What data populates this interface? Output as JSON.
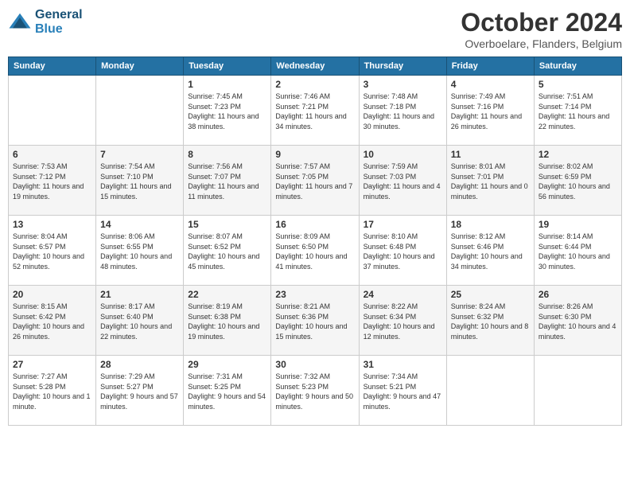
{
  "header": {
    "logo_line1": "General",
    "logo_line2": "Blue",
    "title": "October 2024",
    "subtitle": "Overboelare, Flanders, Belgium"
  },
  "days_of_week": [
    "Sunday",
    "Monday",
    "Tuesday",
    "Wednesday",
    "Thursday",
    "Friday",
    "Saturday"
  ],
  "weeks": [
    [
      {
        "day": "",
        "sunrise": "",
        "sunset": "",
        "daylight": ""
      },
      {
        "day": "",
        "sunrise": "",
        "sunset": "",
        "daylight": ""
      },
      {
        "day": "1",
        "sunrise": "Sunrise: 7:45 AM",
        "sunset": "Sunset: 7:23 PM",
        "daylight": "Daylight: 11 hours and 38 minutes."
      },
      {
        "day": "2",
        "sunrise": "Sunrise: 7:46 AM",
        "sunset": "Sunset: 7:21 PM",
        "daylight": "Daylight: 11 hours and 34 minutes."
      },
      {
        "day": "3",
        "sunrise": "Sunrise: 7:48 AM",
        "sunset": "Sunset: 7:18 PM",
        "daylight": "Daylight: 11 hours and 30 minutes."
      },
      {
        "day": "4",
        "sunrise": "Sunrise: 7:49 AM",
        "sunset": "Sunset: 7:16 PM",
        "daylight": "Daylight: 11 hours and 26 minutes."
      },
      {
        "day": "5",
        "sunrise": "Sunrise: 7:51 AM",
        "sunset": "Sunset: 7:14 PM",
        "daylight": "Daylight: 11 hours and 22 minutes."
      }
    ],
    [
      {
        "day": "6",
        "sunrise": "Sunrise: 7:53 AM",
        "sunset": "Sunset: 7:12 PM",
        "daylight": "Daylight: 11 hours and 19 minutes."
      },
      {
        "day": "7",
        "sunrise": "Sunrise: 7:54 AM",
        "sunset": "Sunset: 7:10 PM",
        "daylight": "Daylight: 11 hours and 15 minutes."
      },
      {
        "day": "8",
        "sunrise": "Sunrise: 7:56 AM",
        "sunset": "Sunset: 7:07 PM",
        "daylight": "Daylight: 11 hours and 11 minutes."
      },
      {
        "day": "9",
        "sunrise": "Sunrise: 7:57 AM",
        "sunset": "Sunset: 7:05 PM",
        "daylight": "Daylight: 11 hours and 7 minutes."
      },
      {
        "day": "10",
        "sunrise": "Sunrise: 7:59 AM",
        "sunset": "Sunset: 7:03 PM",
        "daylight": "Daylight: 11 hours and 4 minutes."
      },
      {
        "day": "11",
        "sunrise": "Sunrise: 8:01 AM",
        "sunset": "Sunset: 7:01 PM",
        "daylight": "Daylight: 11 hours and 0 minutes."
      },
      {
        "day": "12",
        "sunrise": "Sunrise: 8:02 AM",
        "sunset": "Sunset: 6:59 PM",
        "daylight": "Daylight: 10 hours and 56 minutes."
      }
    ],
    [
      {
        "day": "13",
        "sunrise": "Sunrise: 8:04 AM",
        "sunset": "Sunset: 6:57 PM",
        "daylight": "Daylight: 10 hours and 52 minutes."
      },
      {
        "day": "14",
        "sunrise": "Sunrise: 8:06 AM",
        "sunset": "Sunset: 6:55 PM",
        "daylight": "Daylight: 10 hours and 48 minutes."
      },
      {
        "day": "15",
        "sunrise": "Sunrise: 8:07 AM",
        "sunset": "Sunset: 6:52 PM",
        "daylight": "Daylight: 10 hours and 45 minutes."
      },
      {
        "day": "16",
        "sunrise": "Sunrise: 8:09 AM",
        "sunset": "Sunset: 6:50 PM",
        "daylight": "Daylight: 10 hours and 41 minutes."
      },
      {
        "day": "17",
        "sunrise": "Sunrise: 8:10 AM",
        "sunset": "Sunset: 6:48 PM",
        "daylight": "Daylight: 10 hours and 37 minutes."
      },
      {
        "day": "18",
        "sunrise": "Sunrise: 8:12 AM",
        "sunset": "Sunset: 6:46 PM",
        "daylight": "Daylight: 10 hours and 34 minutes."
      },
      {
        "day": "19",
        "sunrise": "Sunrise: 8:14 AM",
        "sunset": "Sunset: 6:44 PM",
        "daylight": "Daylight: 10 hours and 30 minutes."
      }
    ],
    [
      {
        "day": "20",
        "sunrise": "Sunrise: 8:15 AM",
        "sunset": "Sunset: 6:42 PM",
        "daylight": "Daylight: 10 hours and 26 minutes."
      },
      {
        "day": "21",
        "sunrise": "Sunrise: 8:17 AM",
        "sunset": "Sunset: 6:40 PM",
        "daylight": "Daylight: 10 hours and 22 minutes."
      },
      {
        "day": "22",
        "sunrise": "Sunrise: 8:19 AM",
        "sunset": "Sunset: 6:38 PM",
        "daylight": "Daylight: 10 hours and 19 minutes."
      },
      {
        "day": "23",
        "sunrise": "Sunrise: 8:21 AM",
        "sunset": "Sunset: 6:36 PM",
        "daylight": "Daylight: 10 hours and 15 minutes."
      },
      {
        "day": "24",
        "sunrise": "Sunrise: 8:22 AM",
        "sunset": "Sunset: 6:34 PM",
        "daylight": "Daylight: 10 hours and 12 minutes."
      },
      {
        "day": "25",
        "sunrise": "Sunrise: 8:24 AM",
        "sunset": "Sunset: 6:32 PM",
        "daylight": "Daylight: 10 hours and 8 minutes."
      },
      {
        "day": "26",
        "sunrise": "Sunrise: 8:26 AM",
        "sunset": "Sunset: 6:30 PM",
        "daylight": "Daylight: 10 hours and 4 minutes."
      }
    ],
    [
      {
        "day": "27",
        "sunrise": "Sunrise: 7:27 AM",
        "sunset": "Sunset: 5:28 PM",
        "daylight": "Daylight: 10 hours and 1 minute."
      },
      {
        "day": "28",
        "sunrise": "Sunrise: 7:29 AM",
        "sunset": "Sunset: 5:27 PM",
        "daylight": "Daylight: 9 hours and 57 minutes."
      },
      {
        "day": "29",
        "sunrise": "Sunrise: 7:31 AM",
        "sunset": "Sunset: 5:25 PM",
        "daylight": "Daylight: 9 hours and 54 minutes."
      },
      {
        "day": "30",
        "sunrise": "Sunrise: 7:32 AM",
        "sunset": "Sunset: 5:23 PM",
        "daylight": "Daylight: 9 hours and 50 minutes."
      },
      {
        "day": "31",
        "sunrise": "Sunrise: 7:34 AM",
        "sunset": "Sunset: 5:21 PM",
        "daylight": "Daylight: 9 hours and 47 minutes."
      },
      {
        "day": "",
        "sunrise": "",
        "sunset": "",
        "daylight": ""
      },
      {
        "day": "",
        "sunrise": "",
        "sunset": "",
        "daylight": ""
      }
    ]
  ]
}
